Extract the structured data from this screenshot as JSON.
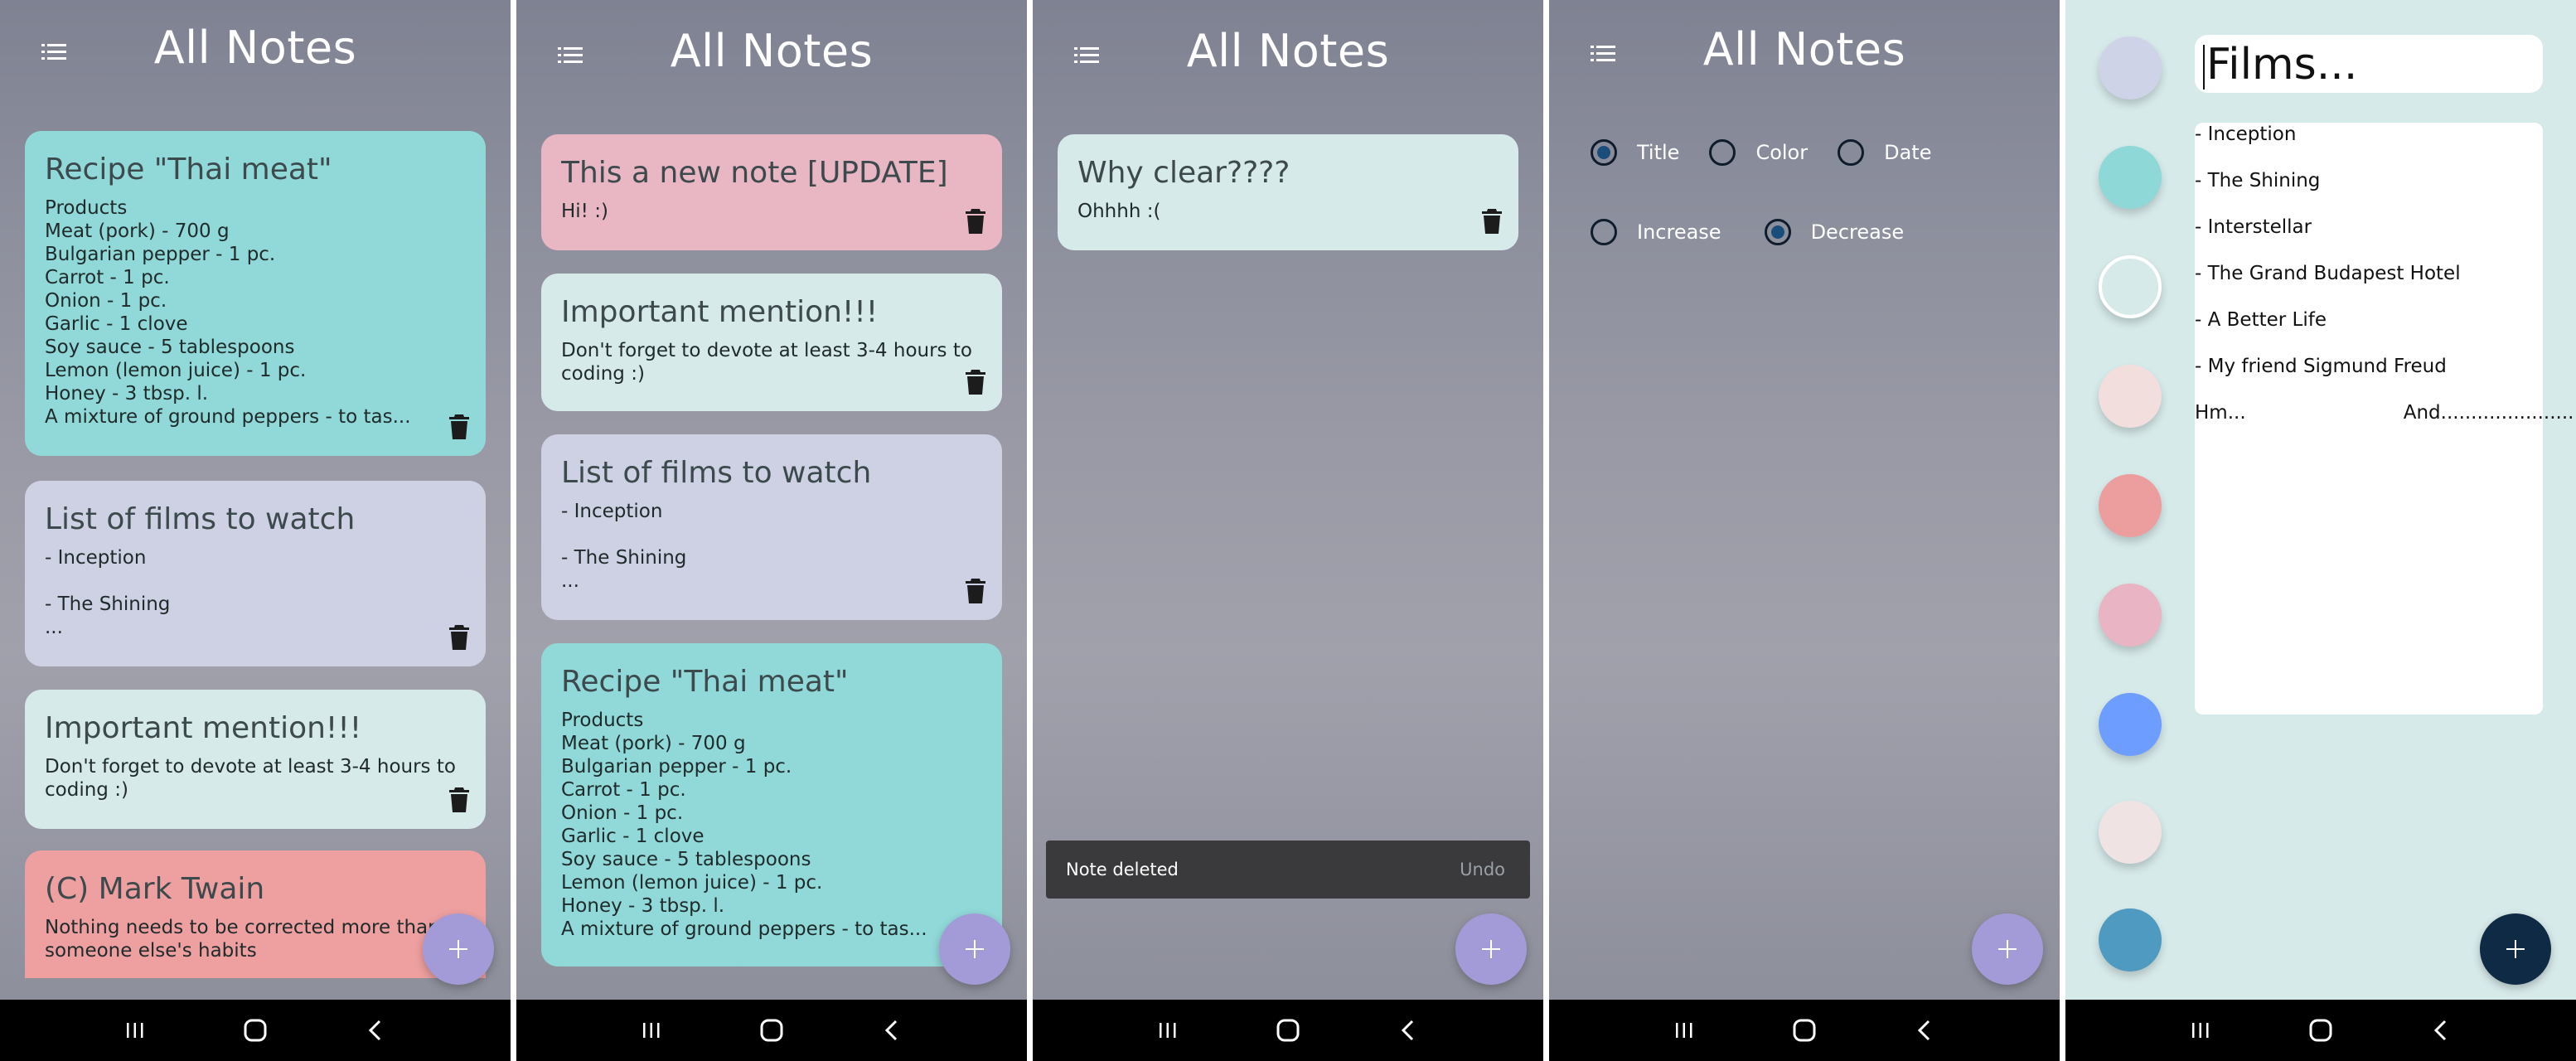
{
  "header_title": "All Notes",
  "screens": [
    {
      "cards": [
        {
          "title": "Recipe \"Thai meat\"",
          "body": "Products\nMeat (pork) - 700 g\nBulgarian pepper - 1 pc.\nCarrot - 1 pc.\nOnion - 1 pc.\nGarlic - 1 clove\nSoy sauce - 5 tablespoons\nLemon (lemon juice) - 1 pc.\nHoney - 3 tbsp. l.\nA mixture of ground peppers - to tas..."
        },
        {
          "title": "List of films to watch",
          "body": "-  Inception\n\n- The Shining\n..."
        },
        {
          "title": "Important mention!!!",
          "body": "Don't forget to devote at least 3-4 hours to\ncoding  :)"
        },
        {
          "title": "(C) Mark Twain",
          "body": "Nothing needs to be corrected more than\nsomeone else's habits"
        }
      ]
    },
    {
      "cards": [
        {
          "title": "This a new note [UPDATE]",
          "body": "Hi! :)"
        },
        {
          "title": "Important mention!!!",
          "body": "Don't forget to devote at least 3-4 hours to\ncoding  :)"
        },
        {
          "title": "List of films to watch",
          "body": "-  Inception\n\n- The Shining\n..."
        },
        {
          "title": "Recipe \"Thai meat\"",
          "body": "Products\nMeat (pork) - 700 g\nBulgarian pepper - 1 pc.\nCarrot - 1 pc.\nOnion - 1 pc.\nGarlic - 1 clove\nSoy sauce - 5 tablespoons\nLemon (lemon juice) - 1 pc.\nHoney - 3 tbsp. l.\nA mixture of ground peppers - to tas..."
        }
      ]
    },
    {
      "cards": [
        {
          "title": "Why clear????",
          "body": " Ohhhh :("
        }
      ],
      "snackbar": {
        "message": "Note deleted",
        "action": "Undo"
      }
    },
    {
      "sort": {
        "options": [
          {
            "label": "Title",
            "checked": true
          },
          {
            "label": "Color",
            "checked": false
          },
          {
            "label": "Date",
            "checked": false
          }
        ],
        "order": [
          {
            "label": "Increase",
            "checked": false
          },
          {
            "label": "Decrease",
            "checked": true
          }
        ]
      }
    },
    {
      "editor": {
        "title": "Films...",
        "lines": [
          "-  Inception",
          "- The Shining",
          "- Interstellar",
          "- The Grand Budapest Hotel",
          "- A Better Life",
          "- My friend Sigmund Freud",
          "Hm...                          And......................"
        ],
        "swatches": [
          "#cfd3e8",
          "#8fd8d8",
          "#d7eaea",
          "#f3dede",
          "#ec9e9e",
          "#e9b4c3",
          "#6d9dff",
          "#efe3e3",
          "#4f9ac0"
        ]
      }
    }
  ]
}
